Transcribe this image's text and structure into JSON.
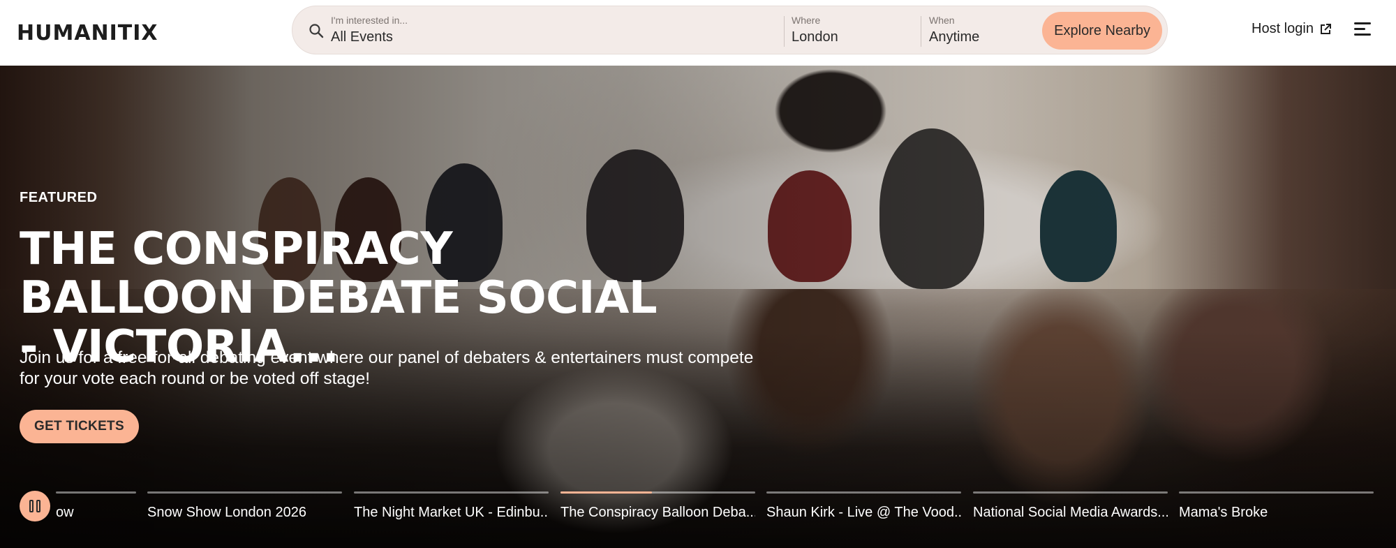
{
  "header": {
    "logo": "HUMANITIX",
    "search": {
      "interest_label": "I'm interested in...",
      "interest_value": "All Events",
      "where_label": "Where",
      "where_value": "London",
      "when_label": "When",
      "when_value": "Anytime",
      "explore_label": "Explore Nearby"
    },
    "host_login": "Host login"
  },
  "hero": {
    "featured_label": "FEATURED",
    "title": "THE CONSPIRACY BALLOON DEBATE SOCIAL - VICTORIA...",
    "description": "Join us for a free-for-all debating event where our panel of debaters & entertainers must compete for your vote each round or be voted off stage!",
    "cta_label": "GET TICKETS"
  },
  "carousel": {
    "slides": [
      {
        "label": "ow",
        "progress": 0
      },
      {
        "label": "Snow Show London 2026",
        "progress": 0
      },
      {
        "label": "The Night Market UK - Edinbu...",
        "progress": 0
      },
      {
        "label": "The Conspiracy Balloon Deba...",
        "progress": 0.47
      },
      {
        "label": "Shaun Kirk - Live @ The Vood...",
        "progress": 0
      },
      {
        "label": "National Social Media Awards...",
        "progress": 0
      },
      {
        "label": "Mama's Broke",
        "progress": 0
      }
    ]
  },
  "colors": {
    "accent": "#fbb494",
    "text_dark": "#1d1d1d",
    "searchbar_bg": "#f3ebe8"
  }
}
